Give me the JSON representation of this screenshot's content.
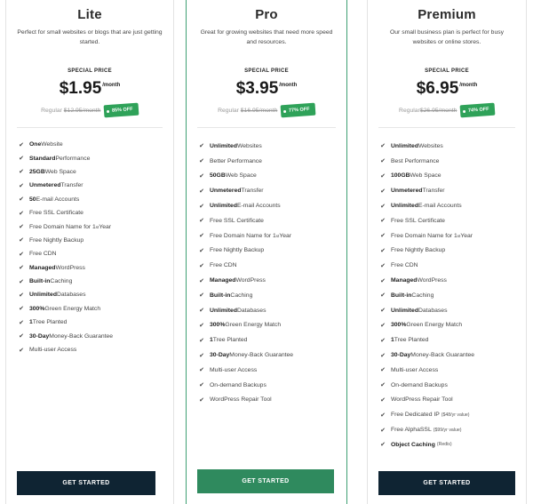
{
  "plans": [
    {
      "name": "Lite",
      "description": "Perfect for small websites or blogs that are just getting started.",
      "special_label": "SPECIAL PRICE",
      "price": "$1.95",
      "per": "/month",
      "regular_label": "Regular ",
      "regular_price": "$12.95/month",
      "discount": "85% OFF",
      "features": [
        {
          "strong": "One",
          "rest": " Website"
        },
        {
          "strong": "Standard",
          "rest": " Performance"
        },
        {
          "strong": "25GB",
          "rest": " Web Space"
        },
        {
          "strong": "Unmetered",
          "rest": " Transfer"
        },
        {
          "strong": "50",
          "rest": " E-mail Accounts"
        },
        {
          "strong": "",
          "rest": "Free SSL Certificate"
        },
        {
          "strong": "",
          "rest": "Free Domain Name for 1",
          "sup": "st",
          "tail": " Year"
        },
        {
          "strong": "",
          "rest": "Free Nightly Backup"
        },
        {
          "strong": "",
          "rest": "Free CDN"
        },
        {
          "strong": "Managed",
          "rest": " WordPress"
        },
        {
          "strong": "Built-in",
          "rest": " Caching"
        },
        {
          "strong": "Unlimited",
          "rest": " Databases"
        },
        {
          "strong": "300%",
          "rest": " Green Energy Match"
        },
        {
          "strong": "1",
          "rest": " Tree Planted"
        },
        {
          "strong": "30-Day",
          "rest": " Money-Back Guarantee"
        },
        {
          "strong": "",
          "rest": "Multi-user Access"
        }
      ],
      "cta": "GET STARTED"
    },
    {
      "name": "Pro",
      "description": "Great for growing websites that need more speed and resources.",
      "special_label": "SPECIAL PRICE",
      "price": "$3.95",
      "per": "/month",
      "regular_label": "Regular ",
      "regular_price": "$16.95/month",
      "discount": "77% OFF",
      "features": [
        {
          "strong": "Unlimited",
          "rest": " Websites"
        },
        {
          "strong": "",
          "rest": "Better Performance"
        },
        {
          "strong": "50GB",
          "rest": " Web Space"
        },
        {
          "strong": "Unmetered",
          "rest": " Transfer"
        },
        {
          "strong": "Unlimited",
          "rest": " E-mail Accounts"
        },
        {
          "strong": "",
          "rest": "Free SSL Certificate"
        },
        {
          "strong": "",
          "rest": "Free Domain Name for 1",
          "sup": "st",
          "tail": " Year"
        },
        {
          "strong": "",
          "rest": "Free Nightly Backup"
        },
        {
          "strong": "",
          "rest": "Free CDN"
        },
        {
          "strong": "Managed",
          "rest": " WordPress"
        },
        {
          "strong": "Built-in",
          "rest": " Caching"
        },
        {
          "strong": "Unlimited",
          "rest": " Databases"
        },
        {
          "strong": "300%",
          "rest": " Green Energy Match"
        },
        {
          "strong": "1",
          "rest": " Tree Planted"
        },
        {
          "strong": "30-Day",
          "rest": " Money-Back Guarantee"
        },
        {
          "strong": "",
          "rest": "Multi-user Access"
        },
        {
          "strong": "",
          "rest": "On-demand Backups"
        },
        {
          "strong": "",
          "rest": "WordPress Repair Tool"
        }
      ],
      "cta": "GET STARTED"
    },
    {
      "name": "Premium",
      "description": "Our small business plan is perfect for busy websites or online stores.",
      "special_label": "SPECIAL PRICE",
      "price": "$6.95",
      "per": "/month",
      "regular_label": "Regular",
      "regular_price": "$26.95/month",
      "discount": "74% OFF",
      "features": [
        {
          "strong": "Unlimited",
          "rest": " Websites"
        },
        {
          "strong": "",
          "rest": "Best Performance"
        },
        {
          "strong": "100GB",
          "rest": " Web Space"
        },
        {
          "strong": "Unmetered",
          "rest": " Transfer"
        },
        {
          "strong": "Unlimited",
          "rest": " E-mail Accounts"
        },
        {
          "strong": "",
          "rest": "Free SSL Certificate"
        },
        {
          "strong": "",
          "rest": "Free Domain Name for 1",
          "sup": "st",
          "tail": " Year"
        },
        {
          "strong": "",
          "rest": "Free Nightly Backup"
        },
        {
          "strong": "",
          "rest": "Free CDN"
        },
        {
          "strong": "Managed",
          "rest": " WordPress"
        },
        {
          "strong": "Built-in",
          "rest": " Caching"
        },
        {
          "strong": "Unlimited",
          "rest": " Databases"
        },
        {
          "strong": "300%",
          "rest": " Green Energy Match"
        },
        {
          "strong": "1",
          "rest": " Tree Planted"
        },
        {
          "strong": "30-Day",
          "rest": " Money-Back Guarantee"
        },
        {
          "strong": "",
          "rest": "Multi-user Access"
        },
        {
          "strong": "",
          "rest": "On-demand Backups"
        },
        {
          "strong": "",
          "rest": "WordPress Repair Tool"
        },
        {
          "strong": "",
          "rest": "Free Dedicated IP",
          "small": "($48/yr value)"
        },
        {
          "strong": "",
          "rest": "Free AlphaSSL",
          "small": "($99/yr value)"
        },
        {
          "strong": "Object Caching",
          "rest": "",
          "small": "(Redis)"
        }
      ],
      "cta": "GET STARTED"
    }
  ],
  "colors": {
    "accent_green": "#2fa259",
    "pro_border": "#3f9f73",
    "cta_dark": "#0f2433",
    "cta_green": "#2f8a5e"
  },
  "icons": {
    "feature_check": "check-icon",
    "discount_tag": "price-tag-icon"
  }
}
